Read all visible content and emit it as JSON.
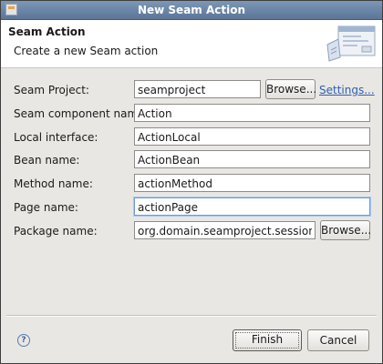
{
  "window": {
    "title": "New Seam Action"
  },
  "banner": {
    "heading": "Seam Action",
    "description": "Create a new Seam action"
  },
  "form": {
    "seam_project": {
      "label": "Seam Project:",
      "value": "seamproject",
      "browse_label": "Browse...",
      "settings_label": "Settings..."
    },
    "component_name": {
      "label": "Seam component name:",
      "value": "Action"
    },
    "local_interface": {
      "label": "Local interface:",
      "value": "ActionLocal"
    },
    "bean_name": {
      "label": "Bean name:",
      "value": "ActionBean"
    },
    "method_name": {
      "label": "Method name:",
      "value": "actionMethod"
    },
    "page_name": {
      "label": "Page name:",
      "value": "actionPage"
    },
    "package_name": {
      "label": "Package name:",
      "value": "org.domain.seamproject.session",
      "browse_label": "Browse..."
    }
  },
  "footer": {
    "help_icon": "help-icon",
    "finish_label": "Finish",
    "cancel_label": "Cancel"
  },
  "colors": {
    "title_bar": "#6a84a6",
    "link": "#2f5fb3",
    "focus": "#6f9ad3"
  }
}
